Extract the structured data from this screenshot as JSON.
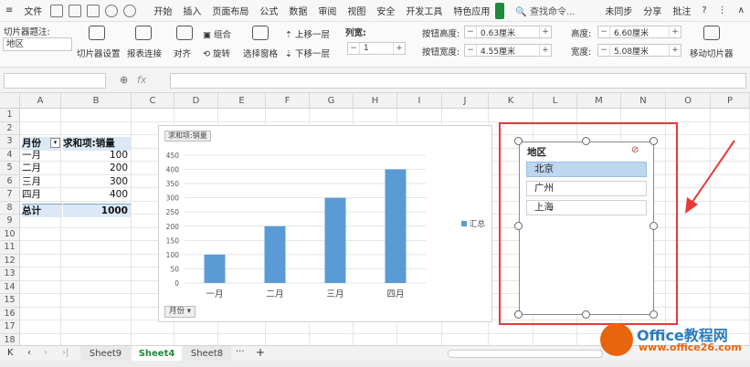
{
  "menubar": {
    "file": "文件",
    "items": [
      "开始",
      "插入",
      "页面布局",
      "公式",
      "数据",
      "审阅",
      "视图",
      "安全",
      "开发工具",
      "特色应用"
    ],
    "search": "查找命令...",
    "sync": "未同步",
    "share": "分享",
    "comment": "批注"
  },
  "ribbon": {
    "caption_label": "切片器题注:",
    "caption_value": "地区",
    "slicer_settings": "切片器设置",
    "report_connections": "报表连接",
    "align": "对齐",
    "group": "组合",
    "rotate": "旋转",
    "selection_pane": "选择窗格",
    "bring_forward": "上移一层",
    "send_backward": "下移一层",
    "columns_label": "列宽:",
    "columns_value": "1",
    "button_height_label": "按钮高度:",
    "button_height_value": "0.63厘米",
    "button_width_label": "按钮宽度:",
    "button_width_value": "4.55厘米",
    "height_label": "高度:",
    "height_value": "6.60厘米",
    "width_label": "宽度:",
    "width_value": "5.08厘米",
    "move_slicer": "移动切片器"
  },
  "formulabar": {
    "fx": "fx"
  },
  "columns": [
    "A",
    "B",
    "C",
    "D",
    "E",
    "F",
    "G",
    "H",
    "I",
    "J",
    "K",
    "L",
    "M",
    "N",
    "O",
    "P"
  ],
  "rows": [
    "1",
    "2",
    "3",
    "4",
    "5",
    "6",
    "7",
    "8",
    "9",
    "10",
    "11",
    "12",
    "13",
    "14",
    "15",
    "16",
    "17",
    "18"
  ],
  "pivot": {
    "header_month": "月份",
    "header_sum": "求和项:销量",
    "rows": [
      {
        "month": "一月",
        "value": "100"
      },
      {
        "month": "二月",
        "value": "200"
      },
      {
        "month": "三月",
        "value": "300"
      },
      {
        "month": "四月",
        "value": "400"
      }
    ],
    "total_label": "总计",
    "total_value": "1000"
  },
  "chart_data": {
    "type": "bar",
    "title": "",
    "field_button": "求和项:销量",
    "axis_button": "月份",
    "categories": [
      "一月",
      "二月",
      "三月",
      "四月"
    ],
    "series": [
      {
        "name": "汇总",
        "values": [
          100,
          200,
          300,
          400
        ]
      }
    ],
    "ylim": [
      0,
      450
    ],
    "yticks": [
      "0",
      "50",
      "100",
      "150",
      "200",
      "250",
      "300",
      "350",
      "400",
      "450"
    ],
    "grid": true,
    "legend": "right",
    "color": "#5b9bd5"
  },
  "slicer": {
    "title": "地区",
    "items": [
      "北京",
      "广州",
      "上海"
    ],
    "selected": "北京"
  },
  "tabs": [
    "Sheet9",
    "Sheet4",
    "Sheet8"
  ],
  "active_tab": "Sheet4",
  "watermark": {
    "brand": "Office教程网",
    "url": "www.office26.com"
  },
  "colors": {
    "accent": "#1e8a3c",
    "highlight": "#e63a3a",
    "slicer_selected": "#bcd7ee"
  }
}
